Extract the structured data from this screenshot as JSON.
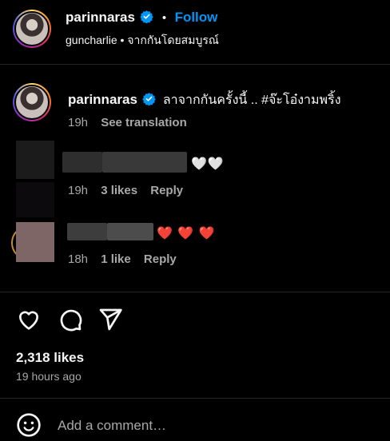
{
  "header": {
    "username": "parinnaras",
    "separator": "•",
    "follow_label": "Follow",
    "subtitle": "guncharlie • จากกันโดยสมบูรณ์"
  },
  "caption": {
    "username": "parinnaras",
    "text": "ลาจากกันครั้งนี้ .. #จ๊ะโอ๋งามพริ้ง",
    "time": "19h",
    "translate_label": "See translation"
  },
  "comments": [
    {
      "emojis": "🤍🤍",
      "time": "19h",
      "likes": "3 likes",
      "reply_label": "Reply"
    },
    {
      "emojis": "❤️ ❤️ ❤️",
      "time": "18h",
      "likes": "1 like",
      "reply_label": "Reply"
    }
  ],
  "footer": {
    "likes": "2,318 likes",
    "posted": "19 hours ago",
    "comment_placeholder": "Add a comment…"
  },
  "colors": {
    "background": "#000000",
    "text": "#f5f5f5",
    "secondary": "#a8a8a8",
    "follow_blue": "#0095f6",
    "verified_blue": "#0095f6",
    "heart_red": "#ed4956"
  },
  "icons": [
    "verified-icon",
    "heart-icon",
    "comment-icon",
    "share-icon",
    "emoji-icon"
  ]
}
